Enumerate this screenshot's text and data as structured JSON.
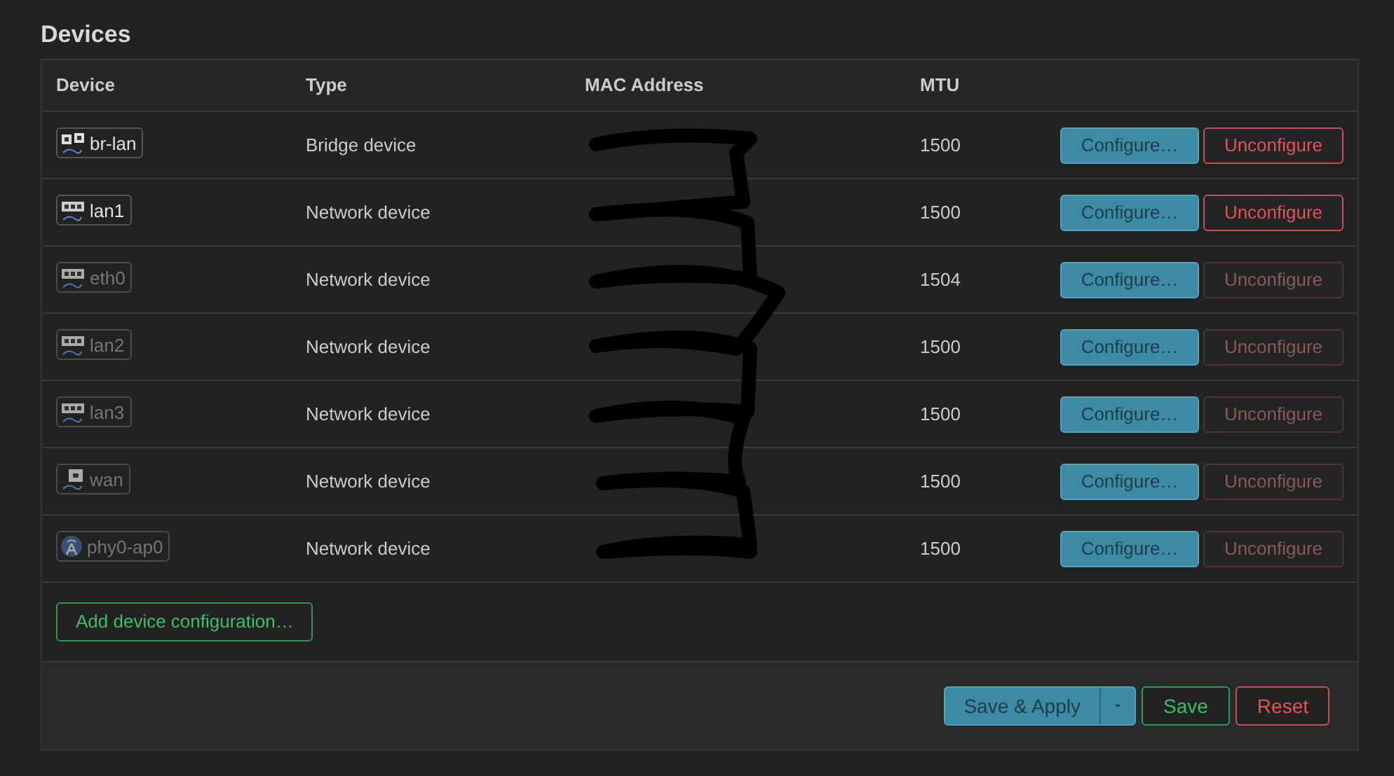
{
  "title": "Devices",
  "table": {
    "columns": [
      "Device",
      "Type",
      "MAC Address",
      "MTU"
    ],
    "rows": [
      {
        "device": "br-lan",
        "kind": "bridge",
        "configured": true,
        "type": "Bridge device",
        "mtu": "1500",
        "configure": "Configure…",
        "unconfigure": "Unconfigure",
        "unconfigure_disabled": false
      },
      {
        "device": "lan1",
        "kind": "ethernet",
        "configured": true,
        "type": "Network device",
        "mtu": "1500",
        "configure": "Configure…",
        "unconfigure": "Unconfigure",
        "unconfigure_disabled": false
      },
      {
        "device": "eth0",
        "kind": "ethernet",
        "configured": false,
        "type": "Network device",
        "mtu": "1504",
        "configure": "Configure…",
        "unconfigure": "Unconfigure",
        "unconfigure_disabled": true
      },
      {
        "device": "lan2",
        "kind": "ethernet",
        "configured": false,
        "type": "Network device",
        "mtu": "1500",
        "configure": "Configure…",
        "unconfigure": "Unconfigure",
        "unconfigure_disabled": true
      },
      {
        "device": "lan3",
        "kind": "ethernet",
        "configured": false,
        "type": "Network device",
        "mtu": "1500",
        "configure": "Configure…",
        "unconfigure": "Unconfigure",
        "unconfigure_disabled": true
      },
      {
        "device": "wan",
        "kind": "port",
        "configured": false,
        "type": "Network device",
        "mtu": "1500",
        "configure": "Configure…",
        "unconfigure": "Unconfigure",
        "unconfigure_disabled": true
      },
      {
        "device": "phy0-ap0",
        "kind": "wireless",
        "configured": false,
        "type": "Network device",
        "mtu": "1500",
        "configure": "Configure…",
        "unconfigure": "Unconfigure",
        "unconfigure_disabled": true
      }
    ]
  },
  "add_button": "Add device configuration…",
  "footer": {
    "save_apply": "Save & Apply",
    "save": "Save",
    "reset": "Reset"
  }
}
